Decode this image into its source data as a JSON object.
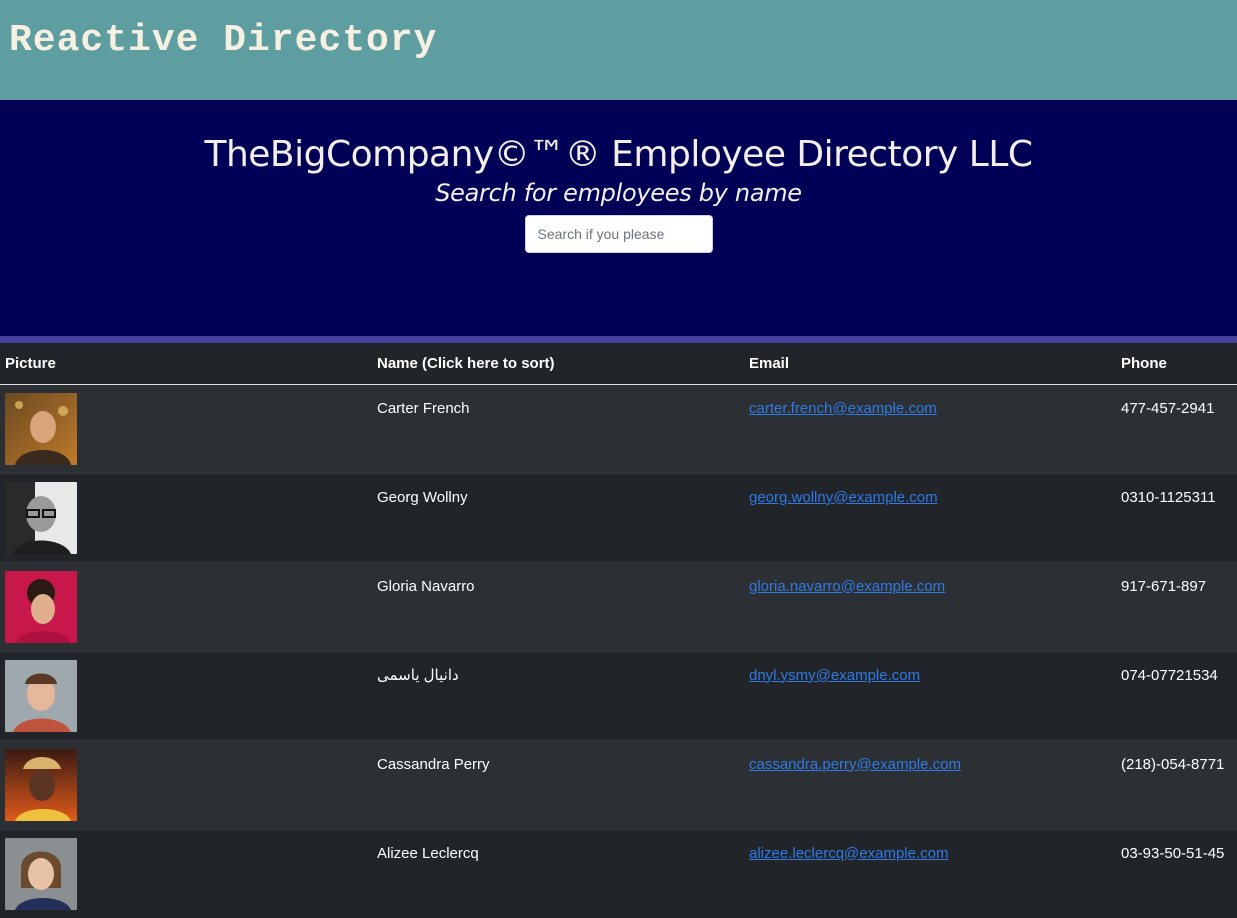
{
  "app_title": "Reactive Directory",
  "hero": {
    "title": "TheBigCompany©™® Employee Directory LLC",
    "subtitle": "Search for employees by name",
    "search_placeholder": "Search if you please"
  },
  "table": {
    "headers": {
      "picture": "Picture",
      "name": "Name (Click here to sort)",
      "email": "Email",
      "phone": "Phone"
    },
    "rows": [
      {
        "name": "Carter French",
        "email": "carter.french@example.com",
        "phone": "477-457-2941"
      },
      {
        "name": "Georg Wollny",
        "email": "georg.wollny@example.com",
        "phone": "0310-1125311"
      },
      {
        "name": "Gloria Navarro",
        "email": "gloria.navarro@example.com",
        "phone": "917-671-897"
      },
      {
        "name": "دانیال یاسمی",
        "email": "dnyl.ysmy@example.com",
        "phone": "074-07721534"
      },
      {
        "name": "Cassandra Perry",
        "email": "cassandra.perry@example.com",
        "phone": "(218)-054-8771"
      },
      {
        "name": "Alizee Leclercq",
        "email": "alizee.leclercq@example.com",
        "phone": "03-93-50-51-45"
      }
    ]
  },
  "colors": {
    "topbar": "#5f9ea0",
    "hero": "#000056",
    "hero_border": "#47409a",
    "table_bg": "#212529",
    "link": "#2f7ae5"
  }
}
